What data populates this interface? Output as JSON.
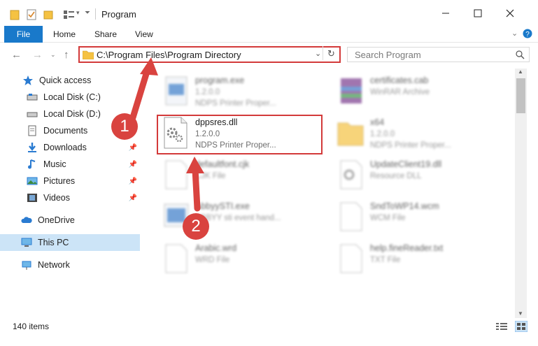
{
  "window": {
    "title": "Program",
    "minimize_icon": "minimize-icon",
    "maximize_icon": "maximize-icon",
    "close_icon": "close-icon"
  },
  "ribbon": {
    "tabs": [
      "File",
      "Home",
      "Share",
      "View"
    ],
    "accent": "#1979ca"
  },
  "address": {
    "path": "C:\\Program Files\\Program Directory",
    "search_placeholder": "Search Program"
  },
  "sidebar": {
    "items": [
      {
        "label": "Quick access",
        "icon": "star-icon"
      },
      {
        "label": "Local Disk (C:)",
        "icon": "drive-icon"
      },
      {
        "label": "Local Disk (D:)",
        "icon": "drive-icon"
      },
      {
        "label": "Documents",
        "icon": "documents-icon"
      },
      {
        "label": "Downloads",
        "icon": "download-icon"
      },
      {
        "label": "Music",
        "icon": "music-icon"
      },
      {
        "label": "Pictures",
        "icon": "pictures-icon"
      },
      {
        "label": "Videos",
        "icon": "videos-icon"
      },
      {
        "label": "OneDrive",
        "icon": "cloud-icon"
      },
      {
        "label": "This PC",
        "icon": "computer-icon"
      },
      {
        "label": "Network",
        "icon": "network-icon"
      }
    ]
  },
  "files": [
    {
      "name": "program.exe",
      "meta1": "1.2.0.0",
      "meta2": "NDPS Printer Proper..."
    },
    {
      "name": "certificates.cab",
      "meta1": "WinRAR Archive",
      "meta2": ""
    },
    {
      "name": "dppsres.dll",
      "meta1": "1.2.0.0",
      "meta2": "NDPS Printer Proper..."
    },
    {
      "name": "x64",
      "meta1": "1.2.0.0",
      "meta2": "NDPS Printer Proper..."
    },
    {
      "name": "defaultfont.cjk",
      "meta1": "CJK File",
      "meta2": ""
    },
    {
      "name": "UpdateClient19.dll",
      "meta1": "Resource DLL",
      "meta2": ""
    },
    {
      "name": "AbbyySTI.exe",
      "meta1": "ABBYY sti event hand...",
      "meta2": ""
    },
    {
      "name": "SndToWP14.wcm",
      "meta1": "WCM File",
      "meta2": ""
    },
    {
      "name": "Arabic.wrd",
      "meta1": "WRD File",
      "meta2": ""
    },
    {
      "name": "help.fineReader.txt",
      "meta1": "TXT File",
      "meta2": ""
    }
  ],
  "status": {
    "items_count": "140 items"
  },
  "annotations": {
    "step1": "1",
    "step2": "2",
    "highlight_color": "#d33a3a"
  }
}
